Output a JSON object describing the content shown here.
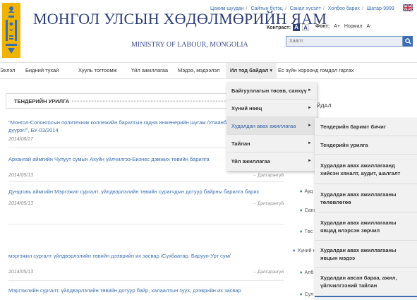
{
  "header": {
    "title": "МОНГОЛ УЛСЫН ХӨДӨЛМӨРИЙН ЯАМ",
    "subtitle": "MINISTRY OF LABOUR, MONGOLIA",
    "top_links": [
      "Цахим шуудан",
      "Сайтын бүтэц",
      "Санал хүсэлт",
      "Холбоо барих",
      "Шатар-9999"
    ],
    "contrast_label": "Контраст:",
    "contrast_dark": "A",
    "contrast_light": "A",
    "font_label": "Фонт:",
    "font_larger": "A+",
    "font_normal": "Нормал",
    "font_smaller": "A-",
    "search_placeholder": "Хайлт"
  },
  "nav": {
    "items": [
      "Эхлэл",
      "Бидний тухай",
      "Хууль тогтоомж",
      "Үйл ажиллагаа",
      "Мэдээ, мэдээлэл",
      "Ил тод байдал ▾",
      "Ёс зүйн хороонд гомдол гаргах"
    ]
  },
  "main": {
    "section_title": "ТЕНДЕРИЙН УРИЛГА",
    "items": [
      {
        "title": "\"Монгол-Солонгосын политехник коллежийн барилгын гадна инженерийн шугам /Улаанбаатар, Хан-Уул дүүрэг/\", БУ-03/2014",
        "date": "2014/08/27",
        "more": ""
      },
      {
        "title": "Архангай аймгийн Чулуут сумын Ахуйн үйлчилгээ-Бизнес дэмжих төвийн барилга",
        "date": "2014/05/13",
        "more": "→ Дэлгэрэнгүй"
      },
      {
        "title": "Дундговь аймгийн Мэргэжил сургалт, үйлдвэрлэлийн төвийн сурагчдын дотуур байрны барилга барих",
        "date": "2014/05/13",
        "more": "→ Дэлгэрэнгүй"
      },
      {
        "title": "мэргэжил сургалт үйлдвэрлэлийн төвийн дээврийн их засвар /Сүхбаатар, Баруун-Урт сум/",
        "date": "2014/05/13",
        "more": "→ Дэлгэрэнгүй"
      },
      {
        "title": "Мэргэжлийн сургалт, үйлдвэрлэлийн төвийн дотуур байр, халаалтын зуух, дээврийн их засвар",
        "date": "",
        "more": ""
      }
    ]
  },
  "right_col": {
    "title": "ЙДАЛ",
    "items": [
      "Ауд",
      "Санх",
      "Төс",
      "Хүний н",
      "Алб",
      "Сул"
    ]
  },
  "menu1": {
    "items": [
      "Байгууллагын төсөв, санхүү",
      "Хүний нөөц",
      "Худалдан авах ажиллагаа",
      "Тайлан",
      "Үйл ажиллагаа"
    ]
  },
  "menu2": {
    "items": [
      "Тендерийн баримт бичиг",
      "Тендерийн урилга",
      "Худалдан авах ажиллагаанд хийсэн хяналт, аудит, шалгалт",
      "Худалдан авах ажиллагааны төлөвлөгөө",
      "Худалдан авах ажиллагааны явцад илэрсэн зөрчил",
      "Худалдан авах ажиллагааны явцын мэдээ",
      "Худалдан авсан бараа, ажил, үйлчилгээний тайлан"
    ]
  },
  "colors": {
    "accent": "#3c6db3",
    "title": "#2c3e78",
    "link": "#3a6fb0",
    "emblem": "#f0b400"
  }
}
